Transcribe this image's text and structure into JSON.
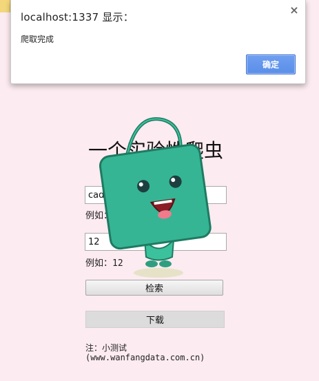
{
  "alert": {
    "title": "localhost:1337 显示：",
    "message": "爬取完成",
    "ok_label": "确定",
    "close_glyph": "×",
    "accent": "#5b8fe9"
  },
  "page": {
    "title": "一个实验性爬虫",
    "keyword_input": {
      "value": "cad"
    },
    "keyword_hint": "例如：cad",
    "pages_input": {
      "value": "12"
    },
    "pages_hint": "例如：12",
    "search_label": "检索",
    "download_label": "下载",
    "note_line1": "注：小测试",
    "note_line2": "(www.wanfangdata.com.cn)"
  },
  "mascot": {
    "icon": "shopping-bag-mascot-icon",
    "body_color": "#35b593"
  },
  "colors": {
    "background": "#fcebf0"
  }
}
